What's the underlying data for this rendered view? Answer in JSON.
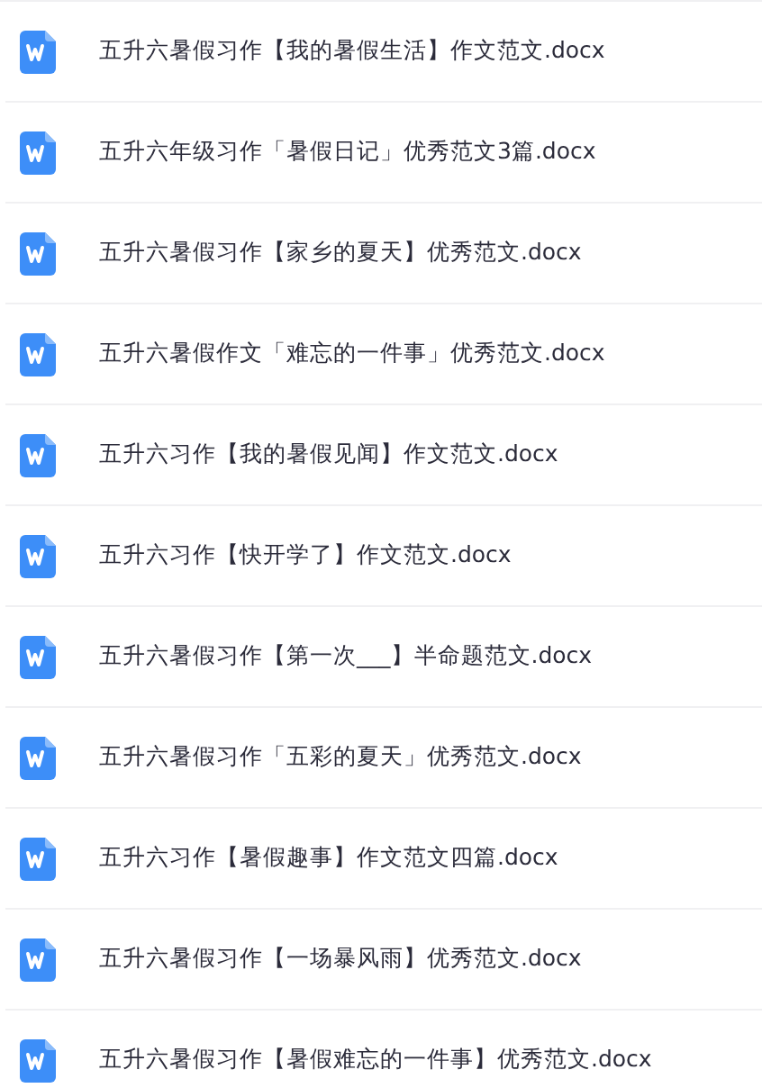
{
  "files": [
    {
      "name": "五升六暑假习作【我的暑假生活】作文范文.docx"
    },
    {
      "name": "五升六年级习作「暑假日记」优秀范文3篇.docx"
    },
    {
      "name": "五升六暑假习作【家乡的夏天】优秀范文.docx"
    },
    {
      "name": "五升六暑假作文「难忘的一件事」优秀范文.docx"
    },
    {
      "name": "五升六习作【我的暑假见闻】作文范文.docx"
    },
    {
      "name": "五升六习作【快开学了】作文范文.docx"
    },
    {
      "name": "五升六暑假习作【第一次___】半命题范文.docx"
    },
    {
      "name": "五升六暑假习作「五彩的夏天」优秀范文.docx"
    },
    {
      "name": "五升六习作【暑假趣事】作文范文四篇.docx"
    },
    {
      "name": "五升六暑假习作【一场暴风雨】优秀范文.docx"
    },
    {
      "name": "五升六暑假习作【暑假难忘的一件事】优秀范文.docx"
    }
  ]
}
